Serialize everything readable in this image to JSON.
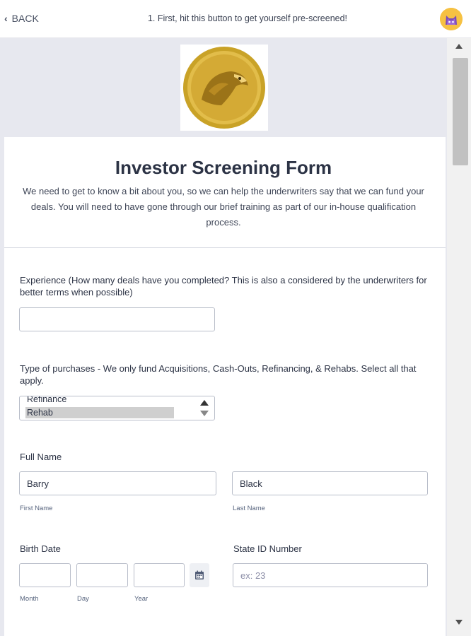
{
  "topbar": {
    "back_label": "BACK",
    "title": "1. First, hit this button to get yourself pre-screened!"
  },
  "icons": {
    "back": "chevron-left-icon",
    "avatar": "cat-avatar-icon",
    "logo": "gold-eagle-coin-logo",
    "calendar": "calendar-icon"
  },
  "colors": {
    "page_background": "#e7e8ef",
    "text": "#2c3345",
    "coin_gold": "#c9a227",
    "avatar": "#f6c142"
  },
  "form": {
    "title": "Investor Screening Form",
    "subtitle": "We need to get to know a bit about you, so we can help the underwriters say that we can fund your deals. You will need to have gone through our brief training as part of our in-house qualification process.",
    "experience": {
      "label": "Experience (How many deals have you completed? This is also a considered by the underwriters for better terms when possible)",
      "value": ""
    },
    "purchases": {
      "label": "Type of purchases - We only fund Acquisitions, Cash-Outs, Refinancing, & Rehabs. Select all that apply.",
      "visible_options": [
        "Refinance",
        "Rehab"
      ],
      "selected": "Rehab"
    },
    "full_name": {
      "label": "Full Name",
      "first_value": "Barry",
      "first_sublabel": "First Name",
      "last_value": "Black",
      "last_sublabel": "Last Name"
    },
    "birth_date": {
      "label": "Birth Date",
      "month_sublabel": "Month",
      "day_sublabel": "Day",
      "year_sublabel": "Year"
    },
    "state_id": {
      "label": "State ID Number",
      "placeholder": "ex: 23"
    }
  }
}
